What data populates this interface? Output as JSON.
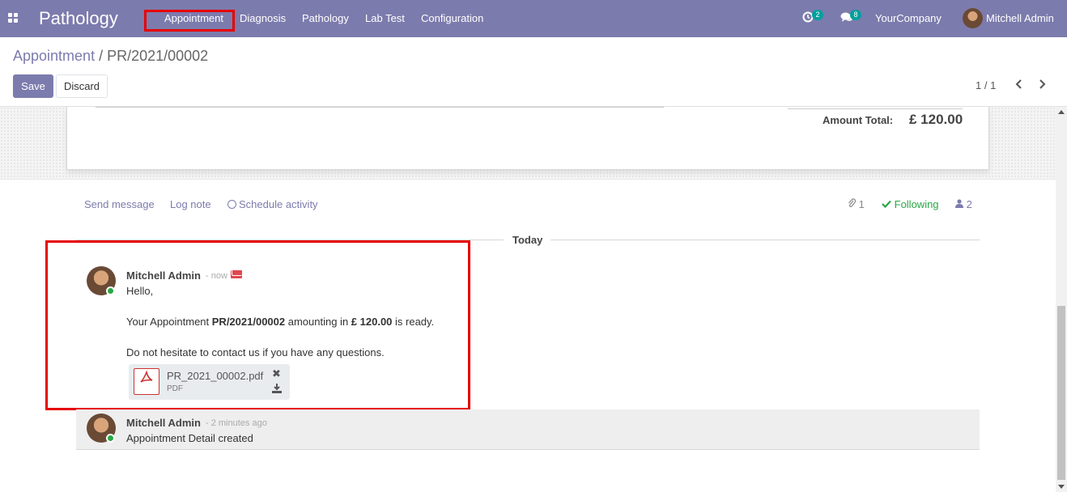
{
  "navbar": {
    "brand": "Pathology",
    "menu": [
      "Appointment",
      "Diagnosis",
      "Pathology",
      "Lab Test",
      "Configuration"
    ],
    "activity_count": "2",
    "message_count": "8",
    "company": "YourCompany",
    "user": "Mitchell Admin",
    "background_color": "#7c7bad"
  },
  "breadcrumb": {
    "parent": "Appointment",
    "separator": "/",
    "current": "PR/2021/00002"
  },
  "buttons": {
    "save": "Save",
    "discard": "Discard"
  },
  "pager": {
    "value": "1 / 1"
  },
  "totals": {
    "amount_label": "Amount Total:",
    "amount_value": "£ 120.00"
  },
  "chatter": {
    "send_message": "Send message",
    "log_note": "Log note",
    "schedule_activity": "Schedule activity",
    "attachment_count": "1",
    "following": "Following",
    "follower_count": "2",
    "date_separator": "Today"
  },
  "messages": [
    {
      "author": "Mitchell Admin",
      "time": "- now",
      "greeting": "Hello,",
      "line1_prefix": "Your Appointment ",
      "line1_ref": "PR/2021/00002",
      "line1_mid": " amounting in ",
      "line1_amount": "£ 120.00",
      "line1_suffix": " is ready.",
      "line2": "Do not hesitate to contact us if you have any questions.",
      "attachment": {
        "name": "PR_2021_00002.pdf",
        "type": "PDF"
      }
    },
    {
      "author": "Mitchell Admin",
      "time": "- 2 minutes ago",
      "body": "Appointment Detail created"
    }
  ],
  "colors": {
    "accent": "#7c7bad",
    "highlight_box": "#e60000",
    "following": "#28a745",
    "badge": "#00a09d"
  }
}
